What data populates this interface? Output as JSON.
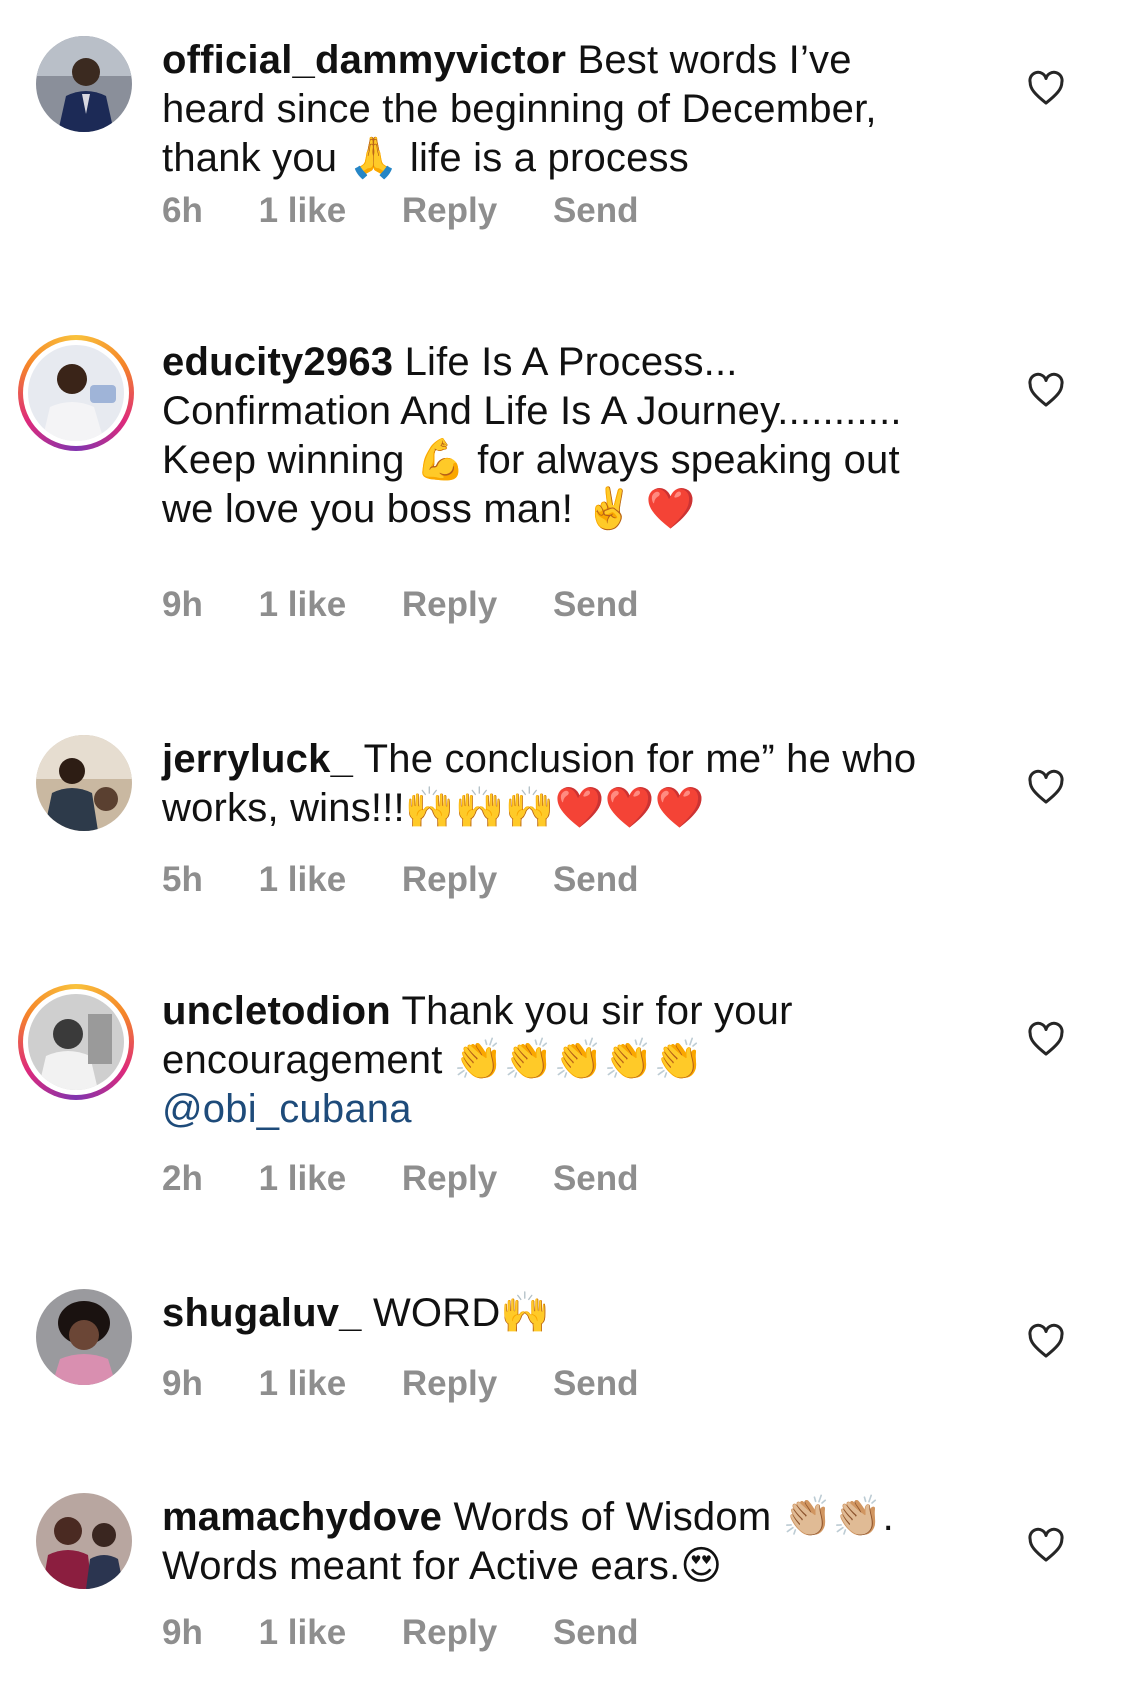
{
  "comments": [
    {
      "username": "official_dammyvictor",
      "text": "Best words I’ve heard since the beginning of December, thank you 🙏 life is a process",
      "time": "6h",
      "likes": "1 like",
      "reply": "Reply",
      "send": "Send",
      "ring": false
    },
    {
      "username": "educity2963",
      "text": "Life Is A Process... Confirmation And Life Is A Journey........... Keep winning 💪 for always speaking out we love you boss man! ✌️ ❤️",
      "time": "9h",
      "likes": "1 like",
      "reply": "Reply",
      "send": "Send",
      "ring": true
    },
    {
      "username": "jerryluck_",
      "text": "The conclusion for me” he who works, wins!!!🙌🙌🙌❤️❤️❤️",
      "time": "5h",
      "likes": "1 like",
      "reply": "Reply",
      "send": "Send",
      "ring": false
    },
    {
      "username": "uncletodion",
      "text": "Thank you sir for your encouragement 👏👏👏👏👏",
      "mention": "@obi_cubana",
      "time": "2h",
      "likes": "1 like",
      "reply": "Reply",
      "send": "Send",
      "ring": true
    },
    {
      "username": "shugaluv_",
      "text": "WORD🙌",
      "time": "9h",
      "likes": "1 like",
      "reply": "Reply",
      "send": "Send",
      "ring": false
    },
    {
      "username": "mamachydove",
      "text": "Words of Wisdom 👏🏼👏🏼. Words meant for Active ears.😍",
      "time": "9h",
      "likes": "1 like",
      "reply": "Reply",
      "send": "Send",
      "ring": false
    }
  ],
  "icons": {
    "like": "heart-outline-icon"
  },
  "colors": {
    "meta": "#8e8e8e",
    "mention": "#1e4b7a",
    "ring_start": "#f9c23c",
    "ring_end": "#8134af"
  }
}
